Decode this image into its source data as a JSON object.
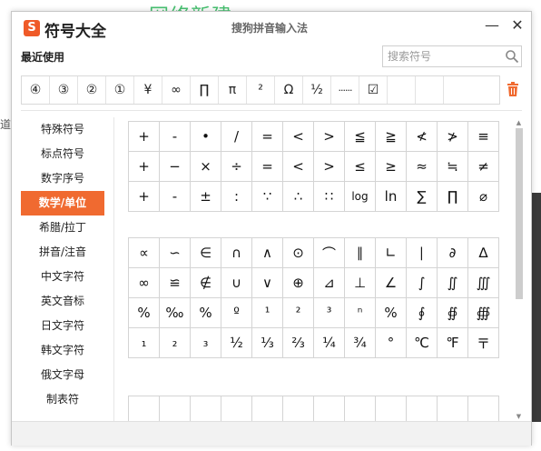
{
  "background": {
    "heading_text": "网络新建",
    "left_char": "道"
  },
  "titlebar": {
    "logo_char": "S",
    "app_title": "符号大全",
    "ime_title": "搜狗拼音输入法",
    "minimize_symbol": "—",
    "close_symbol": "✕"
  },
  "recent": {
    "label": "最近使用",
    "symbols": [
      "④",
      "③",
      "②",
      "①",
      "¥",
      "∞",
      "∏",
      "π",
      "²",
      "Ω",
      "½",
      "······",
      "☑",
      "",
      "",
      ""
    ]
  },
  "search": {
    "placeholder": "搜索符号"
  },
  "sidebar": {
    "items": [
      {
        "label": "特殊符号"
      },
      {
        "label": "标点符号"
      },
      {
        "label": "数字序号"
      },
      {
        "label": "数学/单位"
      },
      {
        "label": "希腊/拉丁"
      },
      {
        "label": "拼音/注音"
      },
      {
        "label": "中文字符"
      },
      {
        "label": "英文音标"
      },
      {
        "label": "日文字符"
      },
      {
        "label": "韩文字符"
      },
      {
        "label": "俄文字母"
      },
      {
        "label": "制表符"
      }
    ],
    "active_index": 3
  },
  "grids": [
    [
      "+",
      "-",
      "•",
      "/",
      "=",
      "<",
      ">",
      "≦",
      "≧",
      "≮",
      "≯",
      "≡",
      "+",
      "−",
      "×",
      "÷",
      "=",
      "<",
      ">",
      "≤",
      "≥",
      "≈",
      "≒",
      "≠",
      "+",
      "-",
      "±",
      ":",
      "∵",
      "∴",
      "∷",
      "log",
      "ln",
      "∑",
      "∏",
      "⌀"
    ],
    [
      "∝",
      "∽",
      "∈",
      "∩",
      "∧",
      "⊙",
      "⌒",
      "∥",
      "∟",
      "∣",
      "∂",
      "∆",
      "∞",
      "≌",
      "∉",
      "∪",
      "∨",
      "⊕",
      "⊿",
      "⊥",
      "∠",
      "∫",
      "∬",
      "∭",
      "%",
      "‰",
      "%",
      "º",
      "¹",
      "²",
      "³",
      "ⁿ",
      "%",
      "∮",
      "∯",
      "∰",
      "₁",
      "₂",
      "₃",
      "½",
      "⅓",
      "⅔",
      "¼",
      "¾",
      "°",
      "℃",
      "℉",
      "〒"
    ],
    [
      "",
      "",
      "",
      "",
      "",
      "",
      "",
      "",
      "",
      "",
      "",
      ""
    ]
  ],
  "colors": {
    "accent": "#f06a30",
    "logo": "#ef5a28",
    "background_heading": "#3fbf6a"
  }
}
